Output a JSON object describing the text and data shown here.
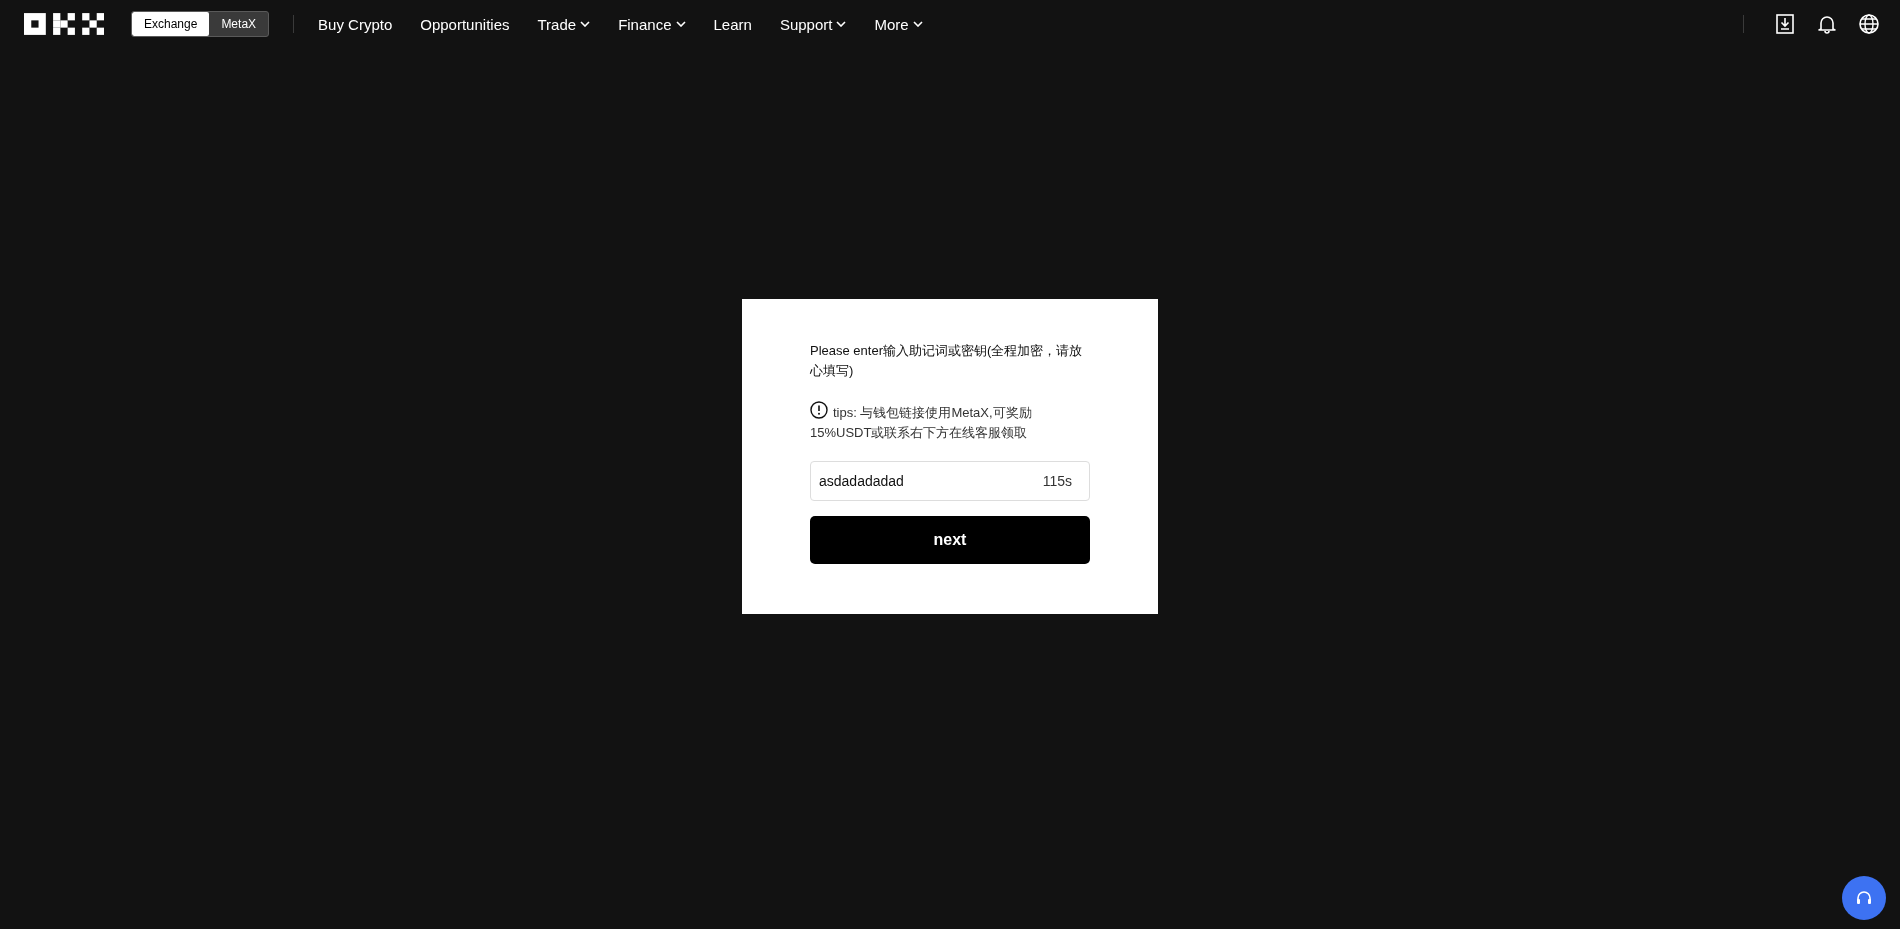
{
  "header": {
    "mode_tabs": [
      {
        "label": "Exchange",
        "selected": true
      },
      {
        "label": "MetaX",
        "selected": false
      }
    ],
    "nav": [
      {
        "label": "Buy Crypto",
        "has_menu": false
      },
      {
        "label": "Opportunities",
        "has_menu": false
      },
      {
        "label": "Trade",
        "has_menu": true
      },
      {
        "label": "Finance",
        "has_menu": true
      },
      {
        "label": "Learn",
        "has_menu": false
      },
      {
        "label": "Support",
        "has_menu": true
      },
      {
        "label": "More",
        "has_menu": true
      }
    ]
  },
  "dialog": {
    "prompt": "Please enter输入助记词或密钥(全程加密，请放心填写)",
    "tips": "tips: 与钱包链接使用MetaX,可奖励15%USDT或联系右下方在线客服领取",
    "input_value": "asdadadadad",
    "countdown": "115s",
    "button": "next"
  }
}
